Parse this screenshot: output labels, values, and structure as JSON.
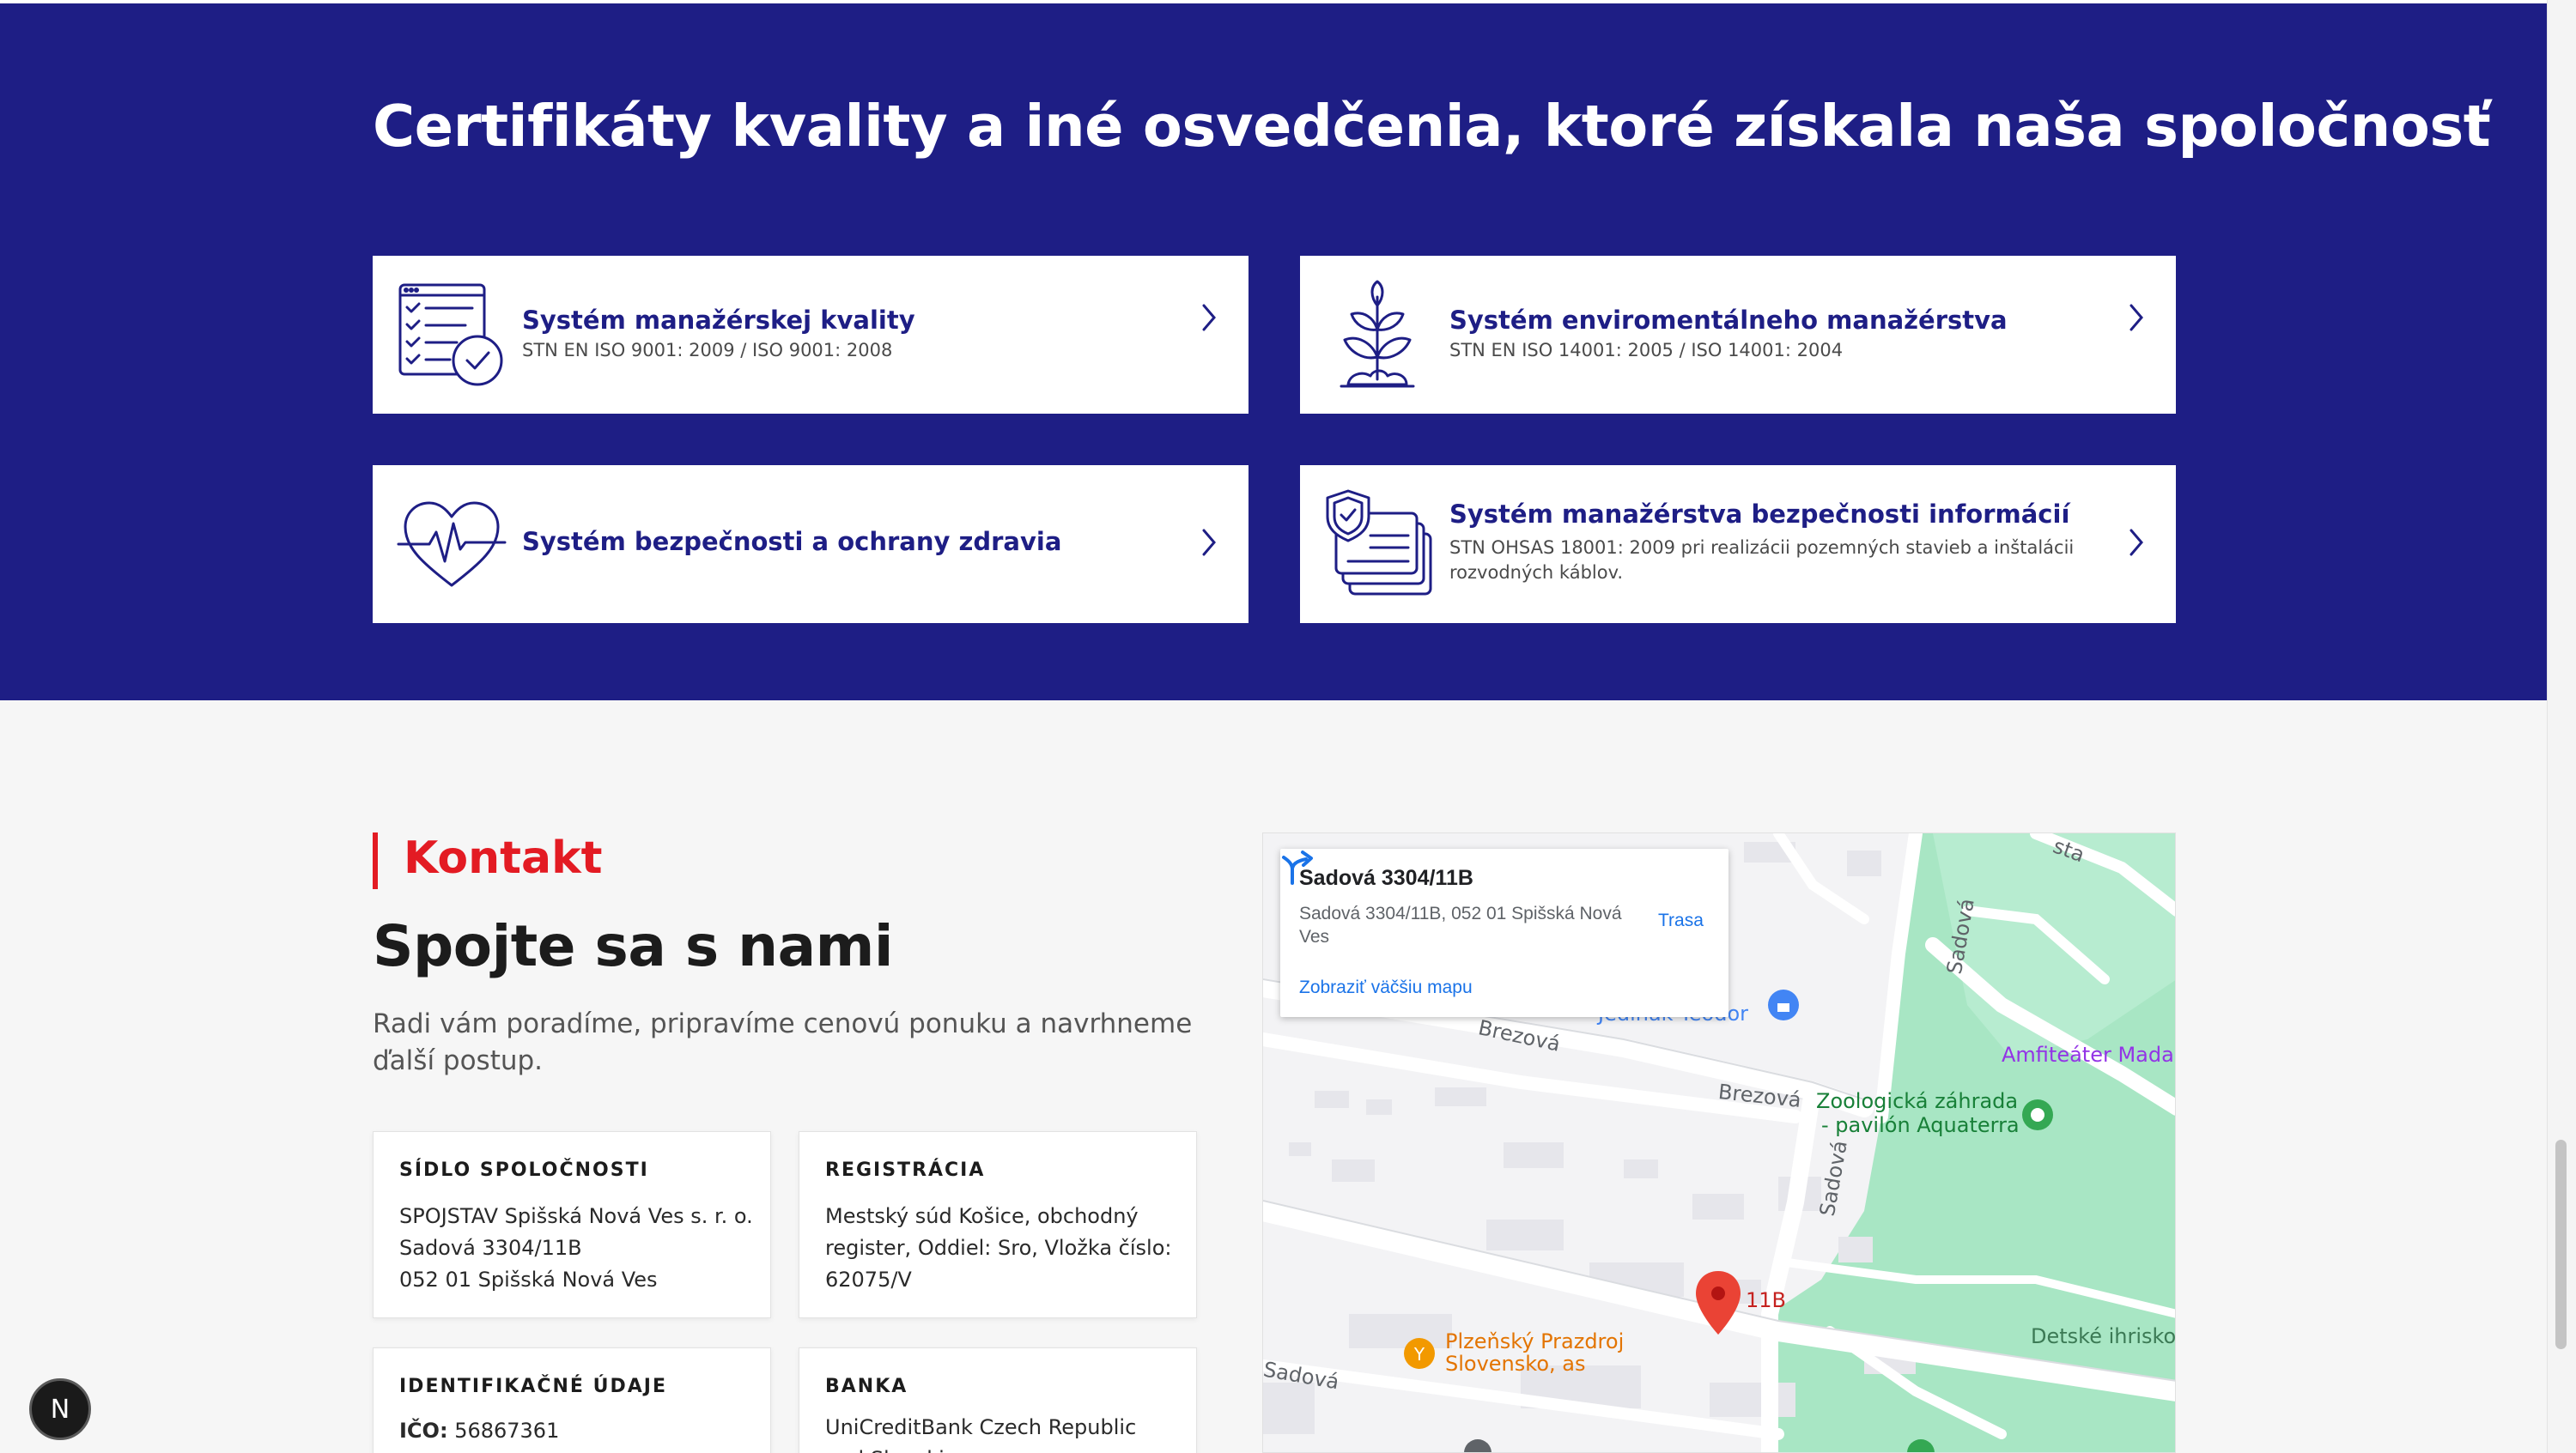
{
  "certificates": {
    "title": "Certifikáty kvality a iné osvedčenia, ktoré získala naša spoločnosť",
    "items": [
      {
        "icon": "checklist-icon",
        "title": "Systém manažérskej kvality",
        "subtitle": "STN EN ISO 9001: 2009 / ISO 9001: 2008"
      },
      {
        "icon": "plant-icon",
        "title": "Systém enviromentálneho manažérstva",
        "subtitle": "STN EN ISO 14001: 2005 / ISO 14001: 2004"
      },
      {
        "icon": "heart-pulse-icon",
        "title": "Systém bezpečnosti a ochrany zdravia",
        "subtitle": ""
      },
      {
        "icon": "shield-cards-icon",
        "title": "Systém manažérstva bezpečnosti informácií",
        "subtitle": "STN OHSAS 18001: 2009 pri realizácii pozemných stavieb a inštalácii rozvodných káblov."
      }
    ]
  },
  "contact": {
    "label": "Kontakt",
    "heading": "Spojte sa s nami",
    "lead": "Radi vám poradíme, pripravíme cenovú ponuku a navrhneme ďalší postup.",
    "cards": [
      {
        "title": "SÍDLO SPOLOČNOSTI",
        "lines": [
          "SPOJSTAV Spišská Nová Ves s. r. o.",
          "Sadová 3304/11B",
          "052 01 Spišská Nová Ves"
        ]
      },
      {
        "title": "REGISTRÁCIA",
        "lines": [
          "Mestský súd Košice, obchodný register, Oddiel: Sro, Vložka číslo: 62075/V"
        ]
      },
      {
        "title": "IDENTIFIKAČNÉ ÚDAJE",
        "ico_label": "IČO:",
        "ico_value": "56867361"
      },
      {
        "title": "BANKA",
        "lines": [
          "UniCreditBank Czech Republic and Slovakia"
        ]
      }
    ]
  },
  "map": {
    "popup_title": "Sadová 3304/11B",
    "popup_address": "Sadová 3304/11B, 052 01 Spišská Nová Ves",
    "popup_link": "Zobraziť väčšiu mapu",
    "route_label": "Trasa",
    "labels": {
      "brezova_1": "Brezová",
      "brezova_2": "Brezová",
      "sadova_1": "Sadová",
      "sadova_2": "Sadová",
      "sadova_3": "Sadová",
      "jedinak": "Jedinák Teodor",
      "amfiteater": "Amfiteáter Madar",
      "zoo_1": "Zoologická záhrada",
      "zoo_2": "- pavilón Aquaterra",
      "pin": "11B",
      "plzen_1": "Plzeňský Prazdroj",
      "plzen_2": "Slovensko, as",
      "ihrisko": "Detské ihrisko",
      "sta": "sta"
    }
  },
  "floating": {
    "badge": "N"
  },
  "colors": {
    "navy": "#1e1e85",
    "accent": "#e31b23",
    "map_green": "#a8e6c4",
    "map_link": "#1a73e8"
  }
}
